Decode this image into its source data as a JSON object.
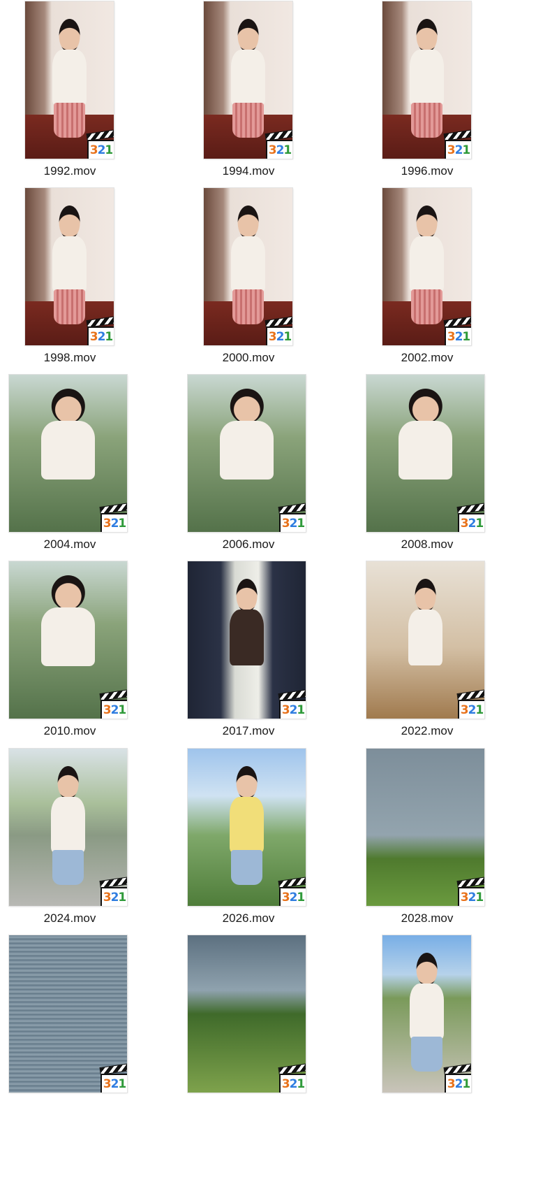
{
  "files": [
    {
      "name": "1992.mov",
      "scene": "indoor"
    },
    {
      "name": "1994.mov",
      "scene": "indoor"
    },
    {
      "name": "1996.mov",
      "scene": "indoor"
    },
    {
      "name": "1998.mov",
      "scene": "indoor"
    },
    {
      "name": "2000.mov",
      "scene": "indoor"
    },
    {
      "name": "2002.mov",
      "scene": "indoor"
    },
    {
      "name": "2004.mov",
      "scene": "garden"
    },
    {
      "name": "2006.mov",
      "scene": "garden"
    },
    {
      "name": "2008.mov",
      "scene": "garden"
    },
    {
      "name": "2010.mov",
      "scene": "garden"
    },
    {
      "name": "2017.mov",
      "scene": "curtain"
    },
    {
      "name": "2022.mov",
      "scene": "room"
    },
    {
      "name": "2024.mov",
      "scene": "park"
    },
    {
      "name": "2026.mov",
      "scene": "lake"
    },
    {
      "name": "2028.mov",
      "scene": "geese"
    },
    {
      "name": "",
      "scene": "water"
    },
    {
      "name": "",
      "scene": "fountain"
    },
    {
      "name": "",
      "scene": "rail"
    }
  ],
  "badge": {
    "digits": [
      "3",
      "2",
      "1"
    ],
    "icon": "media-player-classic-icon",
    "colors": [
      "#e8731c",
      "#2f7de0",
      "#2f9a3a"
    ]
  }
}
